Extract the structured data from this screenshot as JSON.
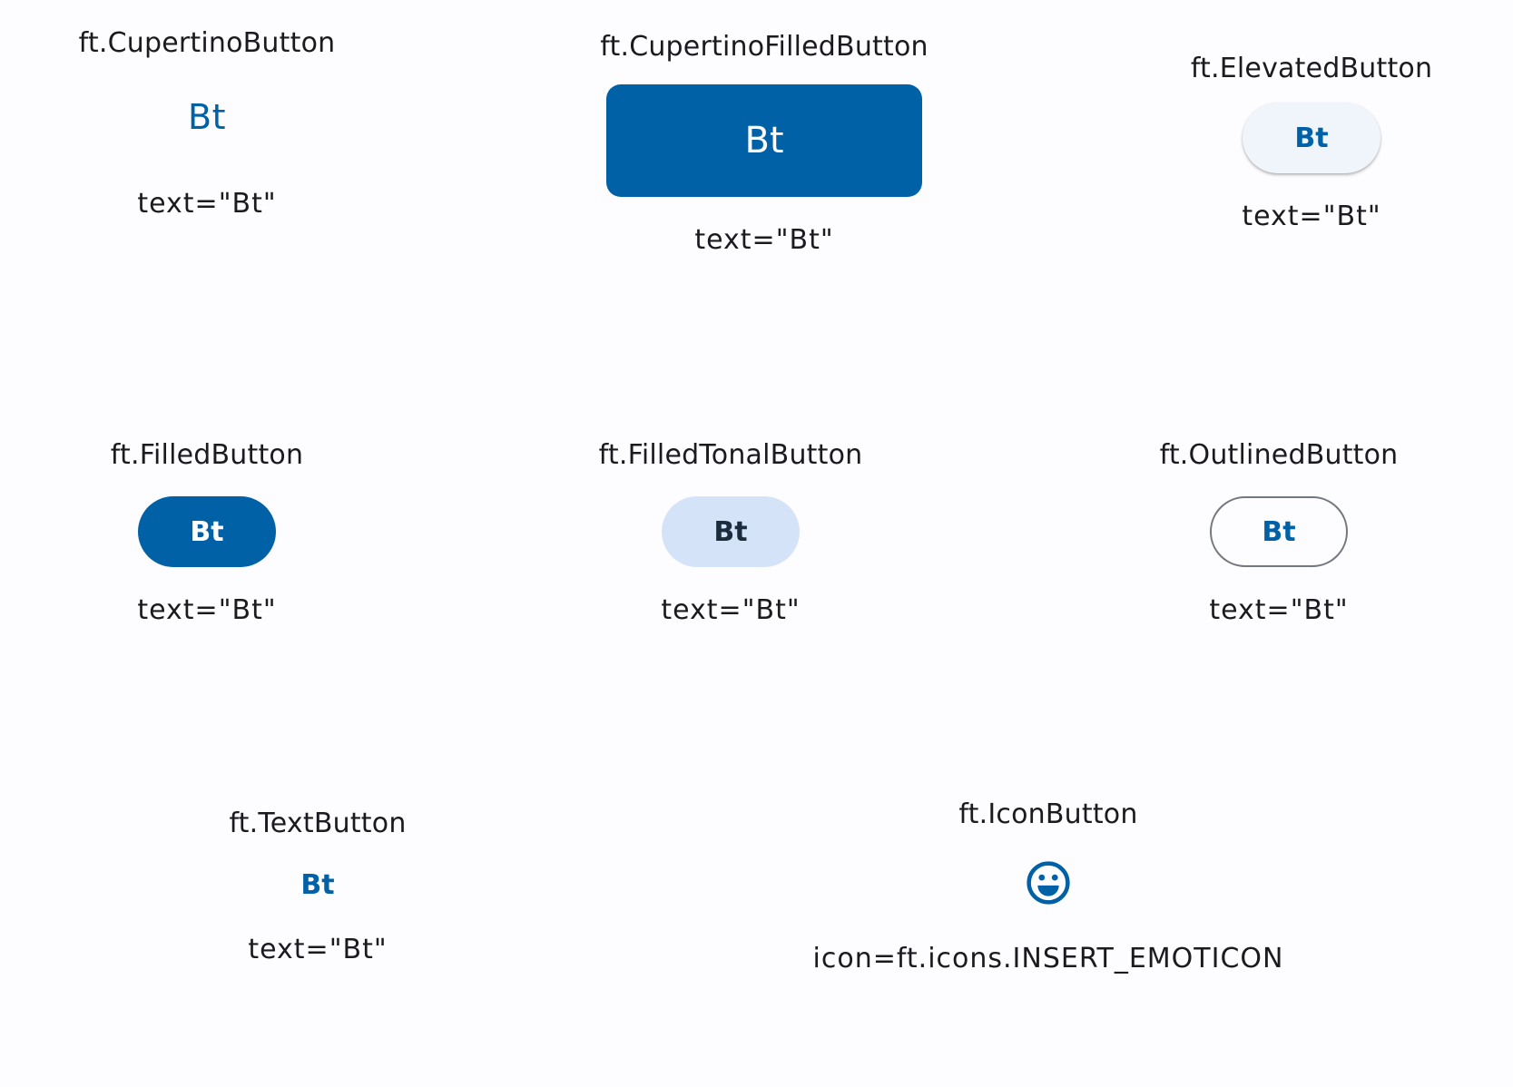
{
  "colors": {
    "background": "#fdfcff",
    "primary": "#0061a6",
    "tonal": "#d5e3f8",
    "outline": "#73777f",
    "text": "#1b1b1f"
  },
  "cupertino": {
    "title": "ft.CupertinoButton",
    "label": "Bt",
    "caption": "text=\"Bt\""
  },
  "cupertino_filled": {
    "title": "ft.CupertinoFilledButton",
    "label": "Bt",
    "caption": "text=\"Bt\""
  },
  "elevated": {
    "title": "ft.ElevatedButton",
    "label": "Bt",
    "caption": "text=\"Bt\""
  },
  "filled": {
    "title": "ft.FilledButton",
    "label": "Bt",
    "caption": "text=\"Bt\""
  },
  "filled_tonal": {
    "title": "ft.FilledTonalButton",
    "label": "Bt",
    "caption": "text=\"Bt\""
  },
  "outlined": {
    "title": "ft.OutlinedButton",
    "label": "Bt",
    "caption": "text=\"Bt\""
  },
  "text_button": {
    "title": "ft.TextButton",
    "label": "Bt",
    "caption": "text=\"Bt\""
  },
  "icon_button": {
    "title": "ft.IconButton",
    "icon": "insert-emoticon-icon",
    "caption": "icon=ft.icons.INSERT_EMOTICON"
  }
}
